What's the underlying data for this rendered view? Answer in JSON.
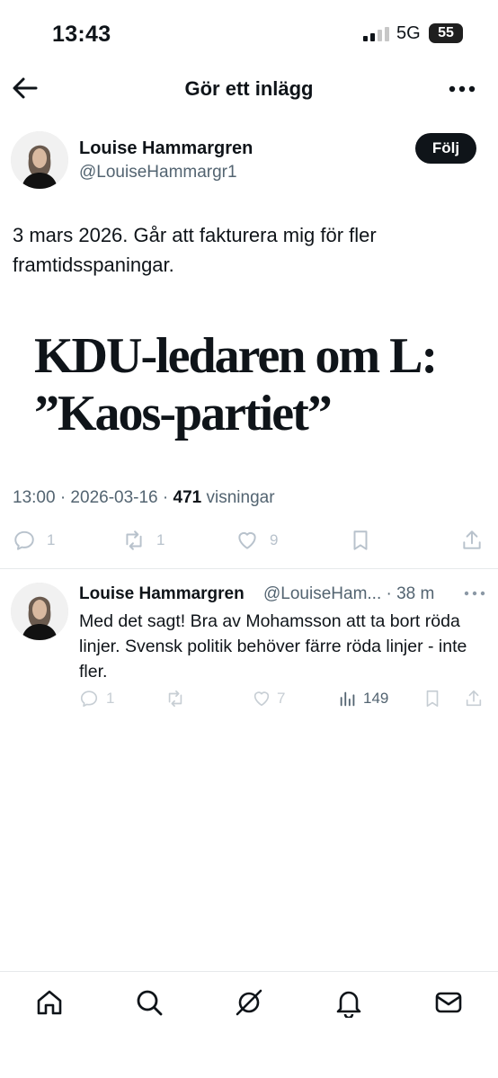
{
  "status_bar": {
    "time": "13:43",
    "network": "5G",
    "battery": "55"
  },
  "header": {
    "title": "Gör ett inlägg"
  },
  "post": {
    "author_name": "Louise Hammargren",
    "author_handle": "@LouiseHammargr1",
    "follow_label": "Följ",
    "text": "3 mars 2026. Går att fakturera mig för fler framtidsspaningar.",
    "image_headline_line1": "KDU-ledaren om L:",
    "image_headline_line2": "”Kaos-partiet”",
    "timestamp": "13:00 · 2026-03-16 · ",
    "views_count": "471",
    "views_label": " visningar",
    "replies": "1",
    "reposts": "1",
    "likes": "9"
  },
  "reply": {
    "author_name": "Louise Hammargren",
    "author_handle": "@LouiseHam... · 38 m",
    "text": "Med det sagt! Bra av Mohamsson att ta bort röda linjer. Svensk politik behöver färre röda linjer - inte fler.",
    "replies": "1",
    "reposts": "",
    "likes": "7",
    "views": "149"
  },
  "tabs": [
    "home-icon",
    "search-icon",
    "grok-icon",
    "notifications-icon",
    "messages-icon"
  ]
}
